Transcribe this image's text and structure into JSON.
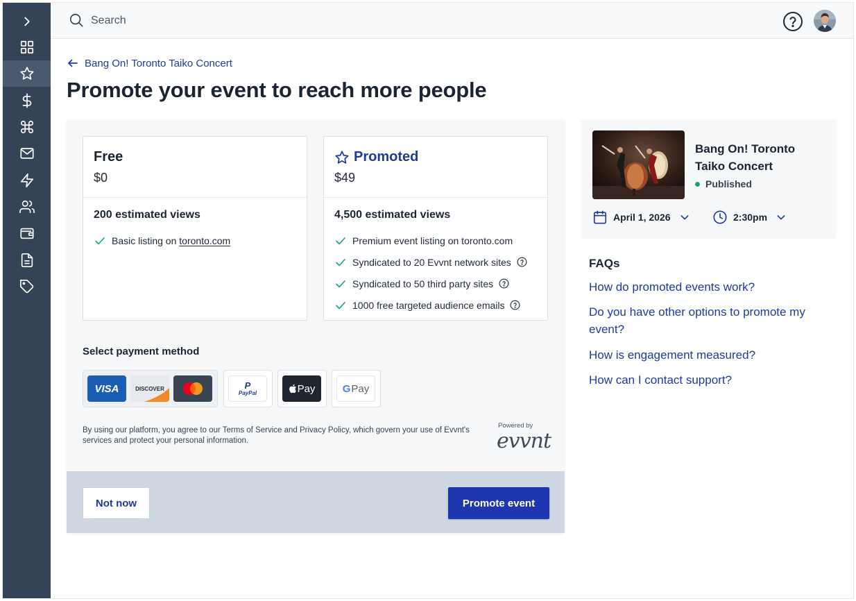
{
  "topbar": {
    "search_placeholder": "Search",
    "help_icon": "help-circle-icon",
    "avatar_icon": "user-avatar"
  },
  "sidebar": {
    "items": [
      {
        "name": "expand",
        "icon": "chevron-right-icon"
      },
      {
        "name": "dashboard",
        "icon": "grid-icon"
      },
      {
        "name": "promote",
        "icon": "star-icon",
        "active": true
      },
      {
        "name": "payments",
        "icon": "dollar-icon"
      },
      {
        "name": "shortcuts",
        "icon": "command-icon"
      },
      {
        "name": "messages",
        "icon": "mail-icon"
      },
      {
        "name": "activity",
        "icon": "bolt-icon"
      },
      {
        "name": "audience",
        "icon": "users-icon"
      },
      {
        "name": "wallet",
        "icon": "wallet-icon"
      },
      {
        "name": "documents",
        "icon": "document-icon"
      },
      {
        "name": "tags",
        "icon": "tag-icon"
      }
    ]
  },
  "breadcrumb": {
    "back_label": "Bang On! Toronto Taiko Concert"
  },
  "page_title": "Promote your event to reach more people",
  "plans": {
    "free": {
      "name": "Free",
      "price": "$0",
      "views": "200 estimated views",
      "features": [
        {
          "prefix": "Basic listing on ",
          "link": "toronto.com"
        }
      ]
    },
    "promoted": {
      "name": "Promoted",
      "price": "$49",
      "views": "4,500 estimated views",
      "features": [
        {
          "text": "Premium event listing on toronto.com",
          "help": false
        },
        {
          "text": "Syndicated to 20 Evvnt network sites",
          "help": true
        },
        {
          "text": "Syndicated to 50 third party sites",
          "help": true
        },
        {
          "text": "1000 free targeted audience emails",
          "help": true
        }
      ]
    }
  },
  "payment": {
    "label": "Select payment method",
    "cards": {
      "visa": "VISA",
      "discover": "DISCOVER",
      "mastercard": "mastercard"
    },
    "paypal": "PayPal",
    "applepay": "Pay",
    "googlepay": "Pay"
  },
  "terms_text": "By using our platform, you agree to our Terms of Service and Privacy Policy, which govern your use of Evvnt's services and protect your personal information.",
  "powered_by": "Powered by",
  "brand": "evvnt",
  "actions": {
    "secondary": "Not now",
    "primary": "Promote event"
  },
  "event": {
    "title": "Bang On! Toronto Taiko Concert",
    "status": "Published",
    "status_color": "#17a673",
    "date": "April 1, 2026",
    "time": "2:30pm"
  },
  "faqs": {
    "title": "FAQs",
    "items": [
      "How do promoted events work?",
      "Do you have other options to promote my event?",
      "How is engagement measured?",
      "How can I contact support?"
    ]
  },
  "colors": {
    "sidebar": "#344356",
    "accent": "#1e3a9e",
    "primary_button": "#1f37ae",
    "success": "#17a673"
  }
}
